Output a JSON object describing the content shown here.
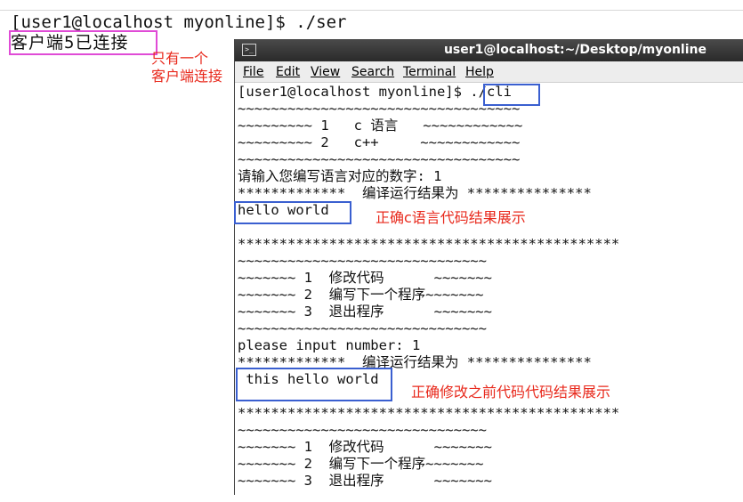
{
  "background_terminal": {
    "line1": "[user1@localhost myonline]$ ./ser",
    "line2": "客户端5已连接"
  },
  "annotations": {
    "one_client": "只有一个\n客户端连接",
    "correct_c": "正确c语言代码结果展示",
    "correct_before": "正确修改之前代码代码结果展示"
  },
  "window": {
    "title": "user1@localhost:~/Desktop/myonline",
    "icon": "terminal-icon",
    "menu": [
      "File",
      "Edit",
      "View",
      "Search",
      "Terminal",
      "Help"
    ]
  },
  "terminal_lines": [
    "[user1@localhost myonline]$ ./cli",
    "~~~~~~~~~~~~~~~~~~~~~~~~~~~~~~~~~~",
    "~~~~~~~~~ 1   c 语言   ~~~~~~~~~~~~",
    "~~~~~~~~~ 2   c++     ~~~~~~~~~~~~",
    "~~~~~~~~~~~~~~~~~~~~~~~~~~~~~~~~~~",
    "请输入您编写语言对应的数字: 1",
    "*************  编译运行结果为 ***************",
    "hello world",
    "",
    "**********************************************",
    "~~~~~~~~~~~~~~~~~~~~~~~~~~~~~~",
    "~~~~~~~ 1  修改代码      ~~~~~~~",
    "~~~~~~~ 2  编写下一个程序~~~~~~~",
    "~~~~~~~ 3  退出程序      ~~~~~~~",
    "~~~~~~~~~~~~~~~~~~~~~~~~~~~~~~",
    "please input number: 1",
    "*************  编译运行结果为 ***************",
    " this hello world",
    "",
    "**********************************************",
    "~~~~~~~~~~~~~~~~~~~~~~~~~~~~~~",
    "~~~~~~~ 1  修改代码      ~~~~~~~",
    "~~~~~~~ 2  编写下一个程序~~~~~~~",
    "~~~~~~~ 3  退出程序      ~~~~~~~"
  ],
  "colors": {
    "magenta_box": "#e04bd6",
    "blue_box": "#3a5fd0",
    "annotation_red": "#e8291c"
  }
}
